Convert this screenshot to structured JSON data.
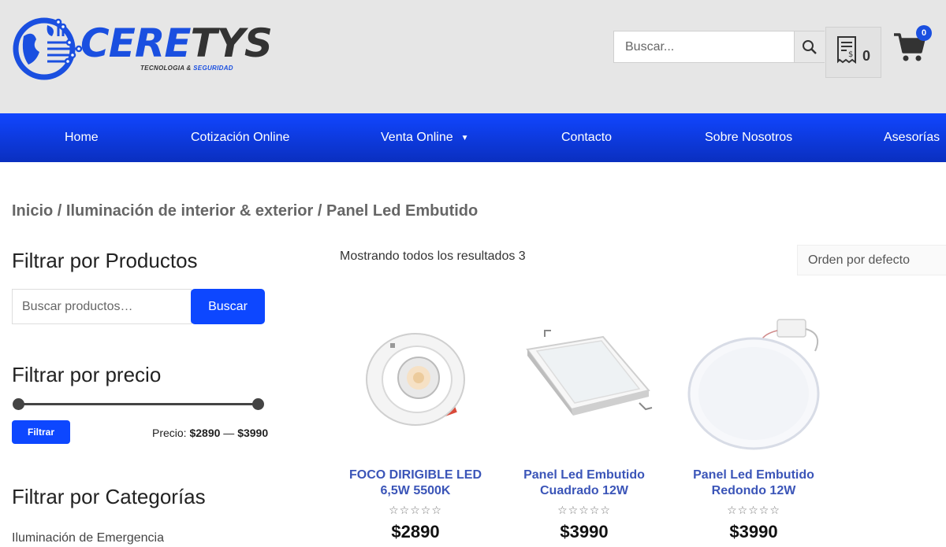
{
  "brand": {
    "name_part1": "CERE",
    "name_part2": "TYS",
    "tagline_part1": "TECNOLOGIA & ",
    "tagline_part2": "SEGURIDAD",
    "accent_color": "#1a4fe0"
  },
  "header": {
    "search_placeholder": "Buscar...",
    "quote_count": "0",
    "cart_count": "0"
  },
  "nav": {
    "items": [
      {
        "label": "Home"
      },
      {
        "label": "Cotización Online"
      },
      {
        "label": "Venta Online"
      },
      {
        "label": "Contacto"
      },
      {
        "label": "Sobre Nosotros"
      },
      {
        "label": "Asesorías"
      }
    ],
    "caret_icon": "caret-down-icon",
    "color": "#0d47ff"
  },
  "breadcrumb": {
    "home": "Inicio",
    "category": "Iluminación de interior & exterior",
    "current": "Panel Led Embutido",
    "sep": " / "
  },
  "sidebar": {
    "products_title": "Filtrar por Productos",
    "products_placeholder": "Buscar productos…",
    "search_button": "Buscar",
    "price_title": "Filtrar por precio",
    "filter_button": "Filtrar",
    "price_prefix": "Precio:",
    "price_min": "$2890",
    "price_dash": " — ",
    "price_max": "$3990",
    "categories_title": "Filtrar por Categorías",
    "categories": [
      "Iluminación de Emergencia"
    ]
  },
  "main": {
    "results_text": "Mostrando todos los resultados 3",
    "orderby_selected": "Orden por defecto",
    "products": [
      {
        "name": "FOCO DIRIGIBLE LED 6,5W 5500K",
        "stars": "☆☆☆☆☆",
        "price": "$2890"
      },
      {
        "name": "Panel Led Embutido Cuadrado 12W",
        "stars": "☆☆☆☆☆",
        "price": "$3990"
      },
      {
        "name": "Panel Led Embutido Redondo 12W",
        "stars": "☆☆☆☆☆",
        "price": "$3990"
      }
    ]
  }
}
